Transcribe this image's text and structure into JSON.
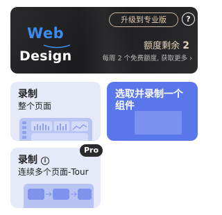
{
  "banner": {
    "logo_line1": "Web",
    "logo_line2": "Design",
    "upgrade_label": "升级到专业版",
    "help_label": "?",
    "quota_label": "额度剩余",
    "quota_count": "2",
    "quota_note": "每周 2 个免费额度, 获取更多 ›",
    "colors": {
      "logo_blue": "#3b8cf0",
      "gold": "#e0ccb2",
      "dark": "#1c1c1e"
    }
  },
  "cards": {
    "record_page": {
      "title": "录制",
      "subtitle": "整个页面"
    },
    "select_record": {
      "title": "选取并录制一个组件"
    },
    "tour": {
      "title": "录制",
      "info_icon": "i",
      "subtitle": "连续多个页面-Tour",
      "badge": "Pro"
    }
  },
  "colors": {
    "card_light": "#e6e9f8",
    "card_blue": "#5a76eb"
  }
}
